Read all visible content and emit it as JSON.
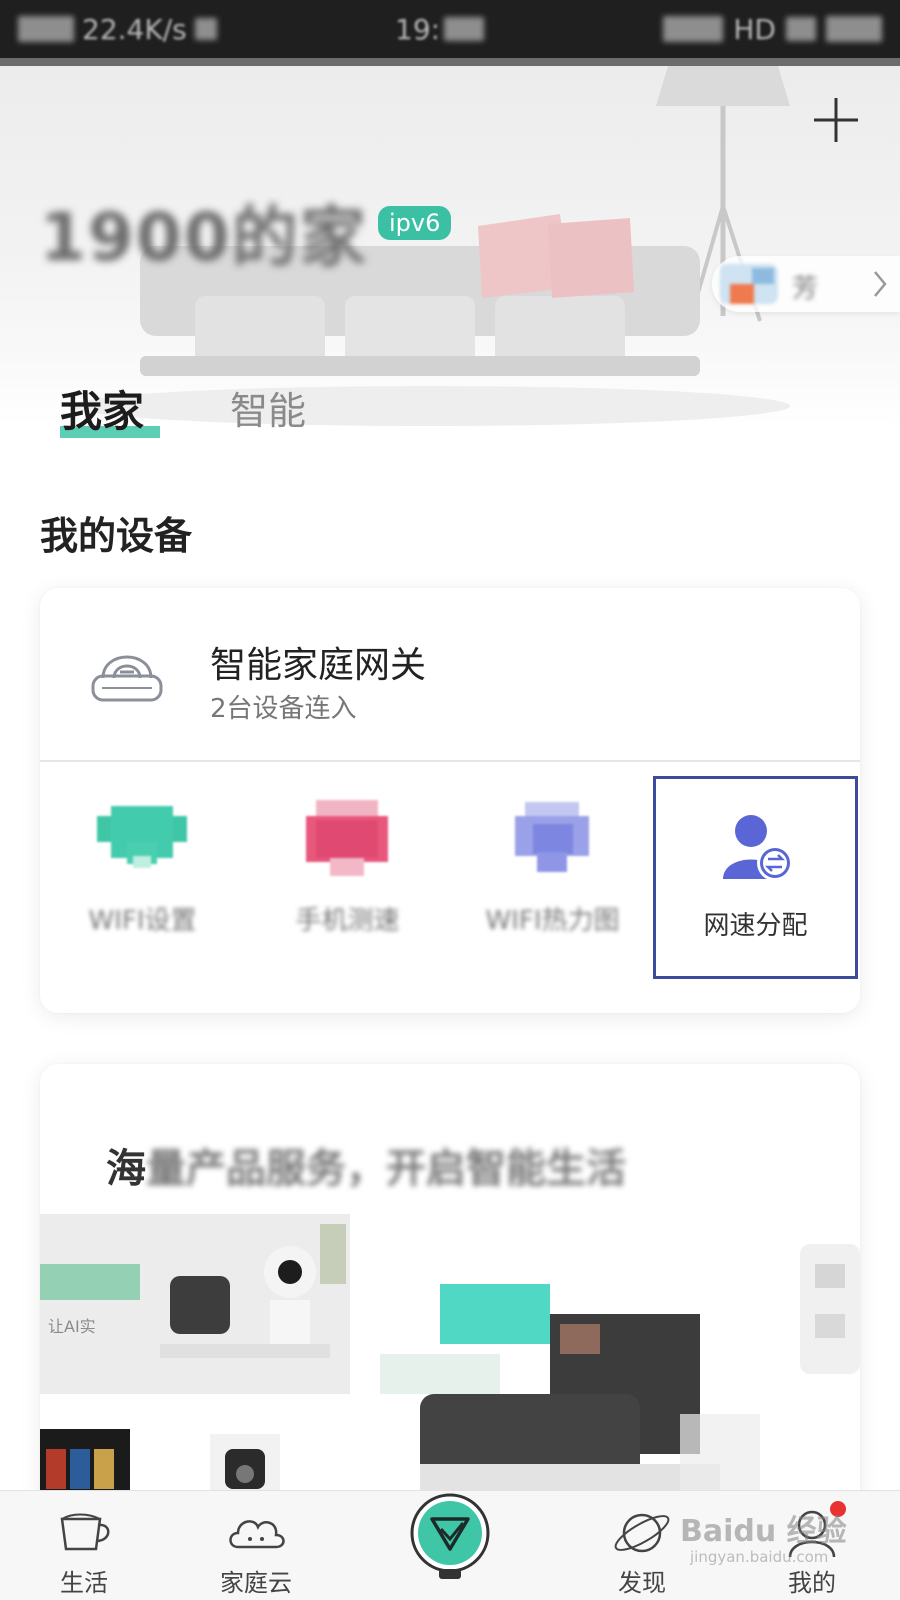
{
  "status_bar": {
    "network_speed": "22.4K/s",
    "time": "19:",
    "network_type": "HD"
  },
  "hero": {
    "home_name": "1900的家",
    "badge": "ipv6",
    "member_name": "芳"
  },
  "tabs": [
    {
      "label": "我家",
      "active": true
    },
    {
      "label": "智能",
      "active": false
    }
  ],
  "section_title": "我的设备",
  "gateway": {
    "title": "智能家庭网关",
    "subtitle": "2台设备连入",
    "tools": [
      {
        "label": "WIFI设置",
        "icon": "wifi-settings-icon",
        "color": "#3ec6a6"
      },
      {
        "label": "手机测速",
        "icon": "speed-test-icon",
        "color": "#e8577c"
      },
      {
        "label": "WIFI热力图",
        "icon": "heatmap-icon",
        "color": "#7d86e0"
      },
      {
        "label": "网速分配",
        "icon": "bandwidth-allocation-icon",
        "color": "#5a66d6"
      }
    ]
  },
  "promo": {
    "title_prefix": "海",
    "title_rest": "量产品服务，开启智能生活",
    "banner_text": "让AI实"
  },
  "bottom_nav": [
    {
      "label": "生活",
      "icon": "cup-icon"
    },
    {
      "label": "家庭云",
      "icon": "cloud-icon"
    },
    {
      "label": "",
      "icon": "home-logo-icon"
    },
    {
      "label": "发现",
      "icon": "planet-icon"
    },
    {
      "label": "我的",
      "icon": "profile-icon"
    }
  ],
  "watermark": {
    "main": "Baidu 经验",
    "sub": "jingyan.baidu.com"
  },
  "colors": {
    "accent": "#3ec6a6",
    "highlight_border": "#3d4b9a",
    "badge": "#3cc0a4"
  }
}
